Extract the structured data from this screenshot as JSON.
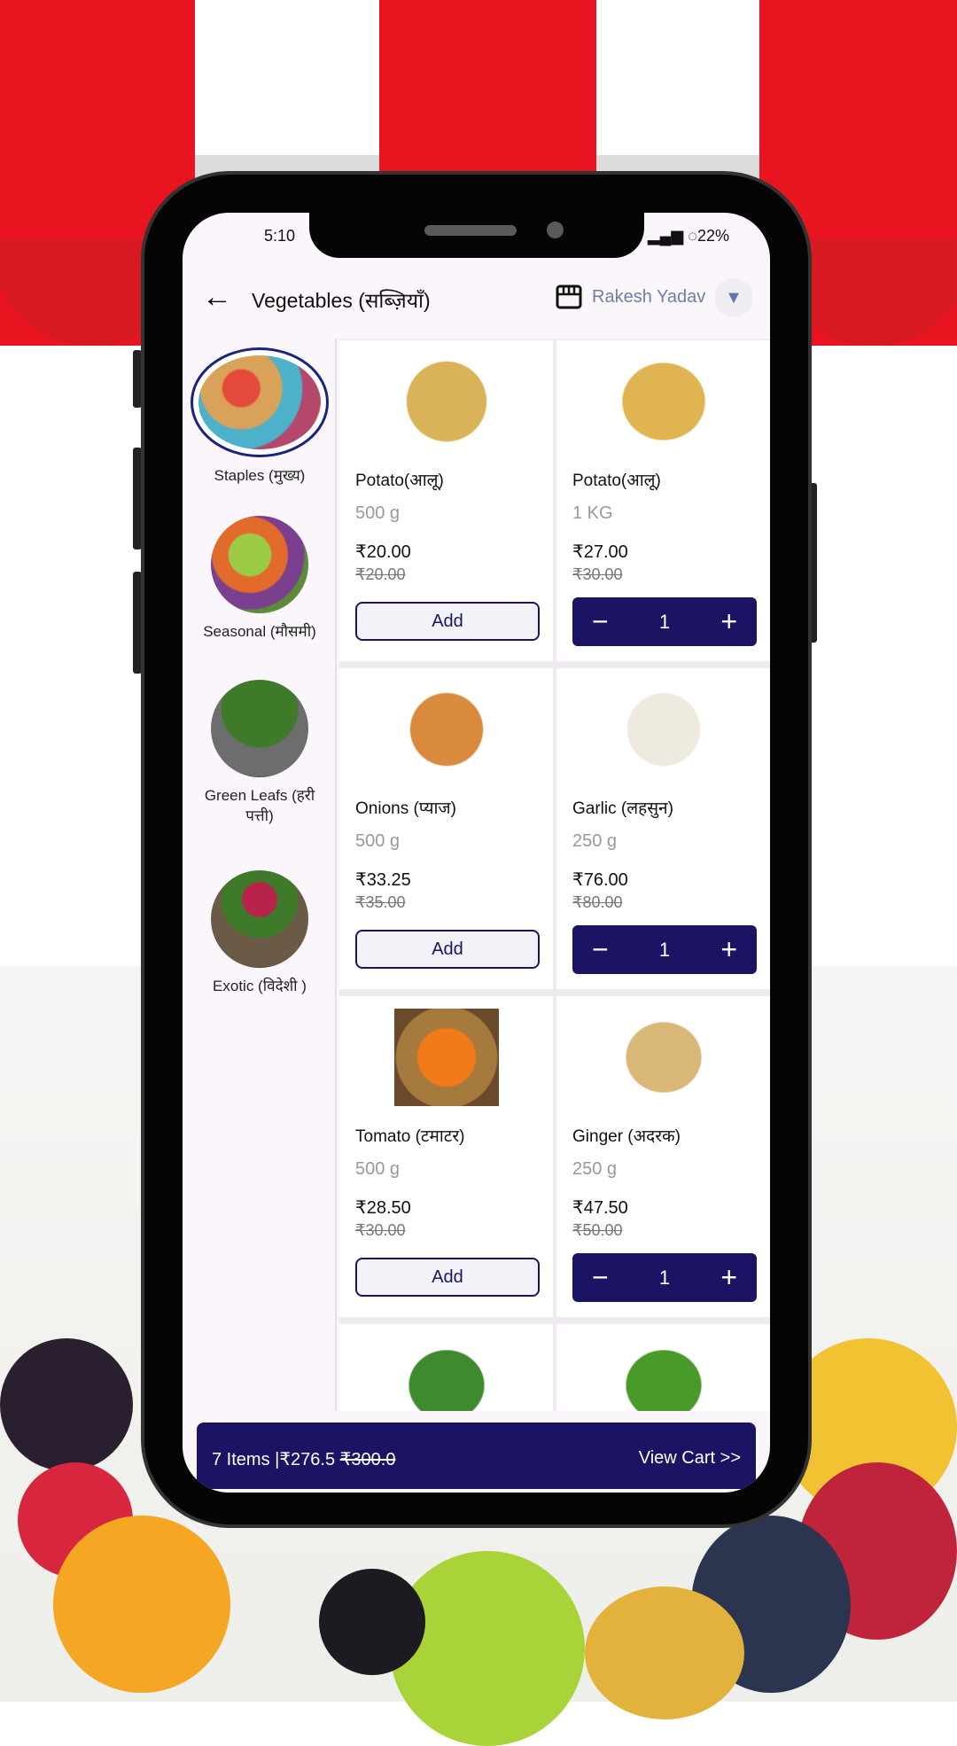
{
  "status_bar": {
    "time": "5:10",
    "battery": "22%"
  },
  "header": {
    "title": "Vegetables (सब्ज़ियाँ)",
    "user": "Rakesh Yadav"
  },
  "categories": [
    {
      "label": "Staples (मुख्य)",
      "selected": true
    },
    {
      "label": "Seasonal (मौसमी)",
      "selected": false
    },
    {
      "label": "Green Leafs (हरी पत्ती)",
      "selected": false
    },
    {
      "label": "Exotic (विदेशी )",
      "selected": false
    }
  ],
  "products": [
    {
      "name": "Potato(आलू)",
      "qty": "500 g",
      "price": "₹20.00",
      "mrp": "₹20.00",
      "action": "Add"
    },
    {
      "name": "Potato(आलू)",
      "qty": "1 KG",
      "price": "₹27.00",
      "mrp": "₹30.00",
      "count": "1"
    },
    {
      "name": "Onions (प्याज)",
      "qty": "500 g",
      "price": "₹33.25",
      "mrp": "₹35.00",
      "action": "Add"
    },
    {
      "name": "Garlic (लहसुन)",
      "qty": "250 g",
      "price": "₹76.00",
      "mrp": "₹80.00",
      "count": "1"
    },
    {
      "name": "Tomato (टमाटर)",
      "qty": "500 g",
      "price": "₹28.50",
      "mrp": "₹30.00",
      "action": "Add"
    },
    {
      "name": "Ginger (अदरक)",
      "qty": "250 g",
      "price": "₹47.50",
      "mrp": "₹50.00",
      "count": "1"
    }
  ],
  "cart": {
    "summary": "7 Items |₹276.5",
    "original": "₹300.0",
    "view": "View Cart >>"
  },
  "colors": {
    "primary": "#1b1464",
    "awning": "#e8141f"
  }
}
